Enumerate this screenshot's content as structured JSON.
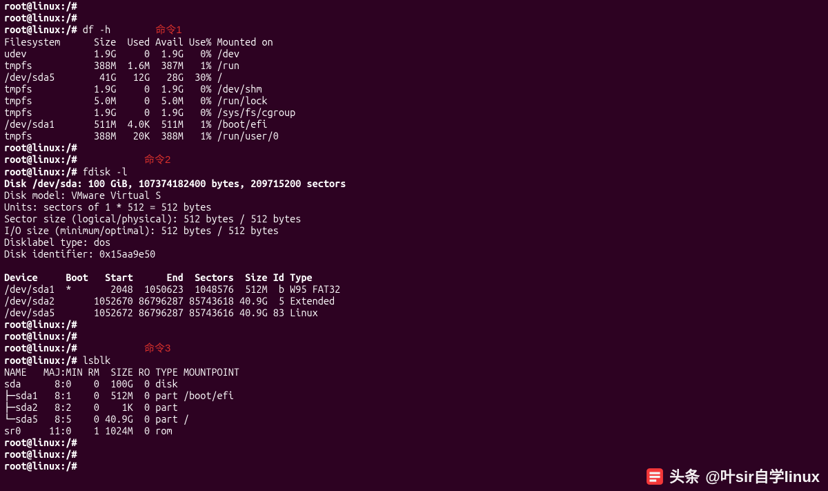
{
  "prompt": "root@linux:/#",
  "blank_prompts": [
    "root@linux:/#",
    "root@linux:/#"
  ],
  "label1": "命令1",
  "cmd1": "df -h",
  "df": {
    "header": "Filesystem      Size  Used Avail Use% Mounted on",
    "rows": [
      "udev            1.9G     0  1.9G   0% /dev",
      "tmpfs           388M  1.6M  387M   1% /run",
      "/dev/sda5        41G   12G   28G  30% /",
      "tmpfs           1.9G     0  1.9G   0% /dev/shm",
      "tmpfs           5.0M     0  5.0M   0% /run/lock",
      "tmpfs           1.9G     0  1.9G   0% /sys/fs/cgroup",
      "/dev/sda1       511M  4.0K  511M   1% /boot/efi",
      "tmpfs           388M   20K  388M   1% /run/user/0"
    ]
  },
  "label2": "命令2",
  "cmd2": "fdisk -l",
  "fdisk": {
    "title": "Disk /dev/sda: 100 GiB, 107374182400 bytes, 209715200 sectors",
    "model": "Disk model: VMware Virtual S",
    "units": "Units: sectors of 1 * 512 = 512 bytes",
    "sector": "Sector size (logical/physical): 512 bytes / 512 bytes",
    "io": "I/O size (minimum/optimal): 512 bytes / 512 bytes",
    "dltype": "Disklabel type: dos",
    "dlid": "Disk identifier: 0x15aa9e50",
    "pheader": "Device     Boot   Start      End  Sectors  Size Id Type",
    "prows": [
      "/dev/sda1  *       2048  1050623  1048576  512M  b W95 FAT32",
      "/dev/sda2       1052670 86796287 85743618 40.9G  5 Extended",
      "/dev/sda5       1052672 86796287 85743616 40.9G 83 Linux"
    ]
  },
  "label3": "命令3",
  "cmd3": "lsblk",
  "lsblk": {
    "header": "NAME   MAJ:MIN RM  SIZE RO TYPE MOUNTPOINT",
    "rows": [
      "sda      8:0    0  100G  0 disk ",
      "├─sda1   8:1    0  512M  0 part /boot/efi",
      "├─sda2   8:2    0    1K  0 part ",
      "└─sda5   8:5    0 40.9G  0 part /",
      "sr0     11:0    1 1024M  0 rom  "
    ]
  },
  "watermark": {
    "prefix": "头条",
    "handle": "@叶sir自学linux"
  }
}
